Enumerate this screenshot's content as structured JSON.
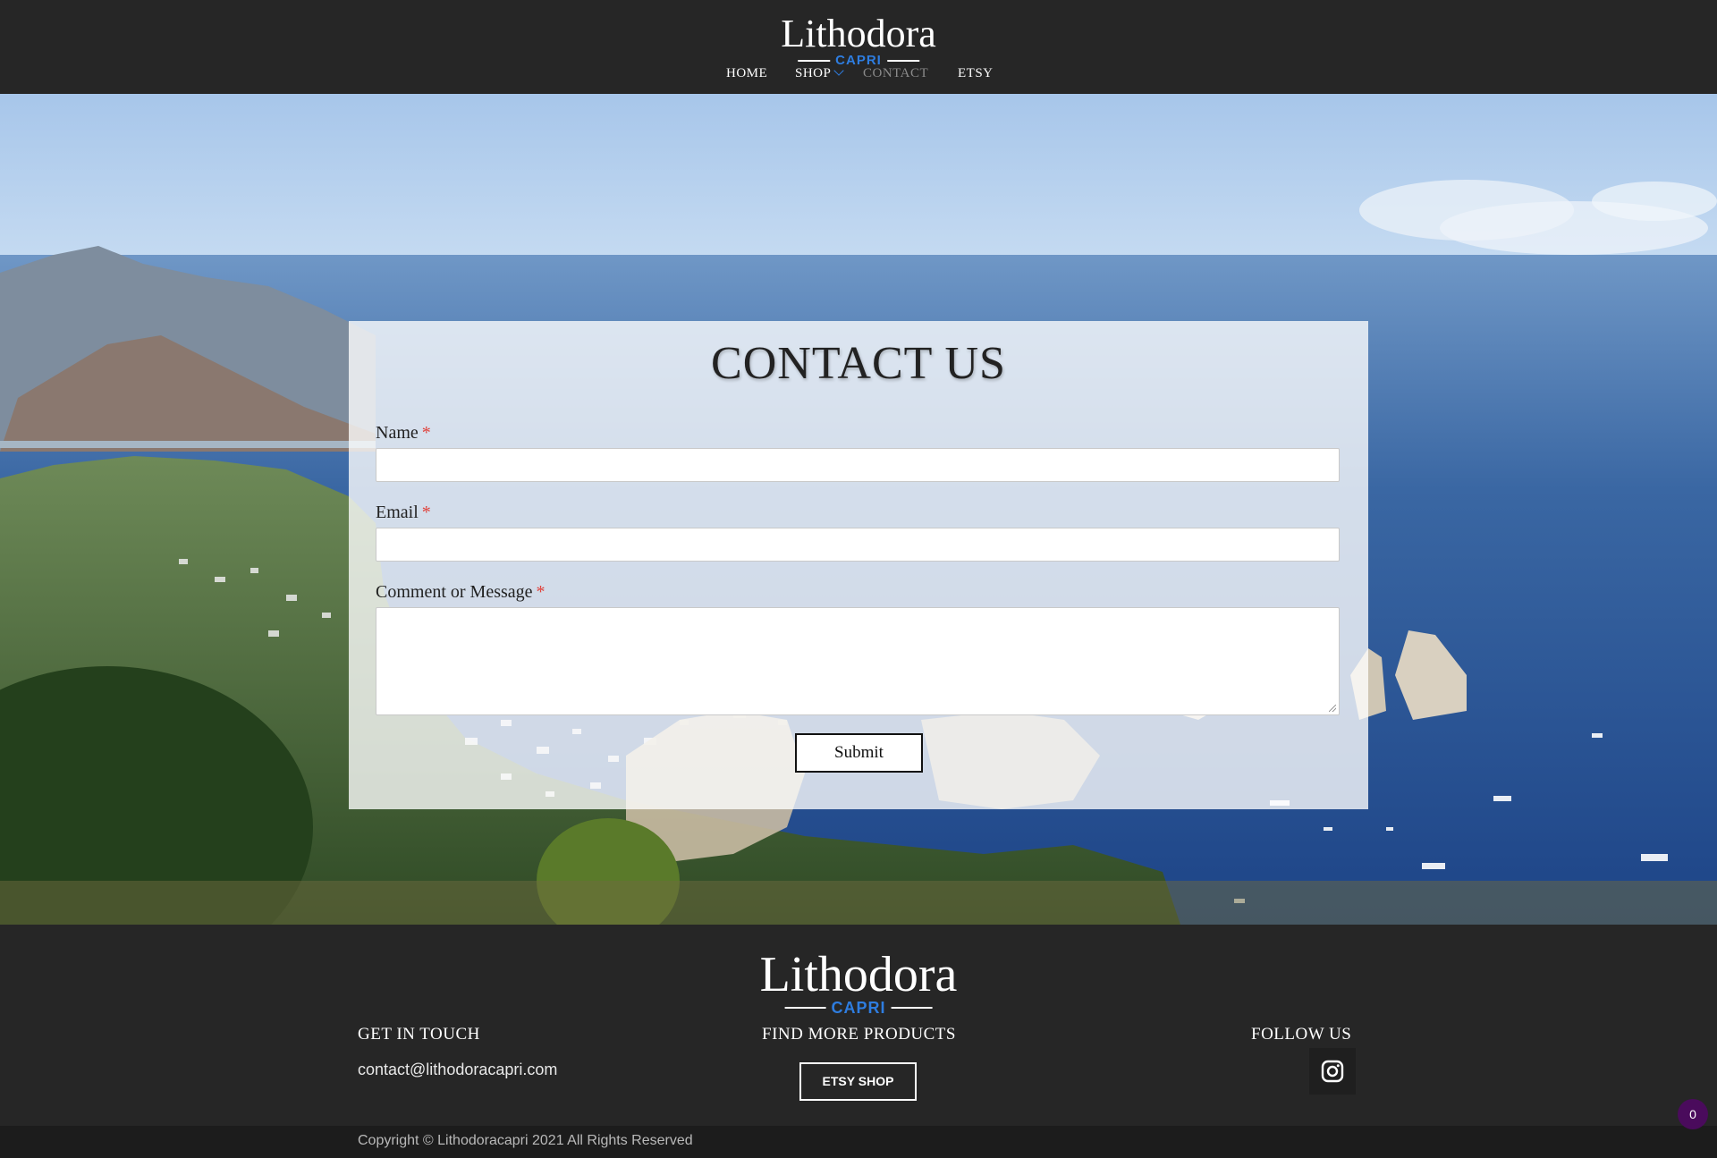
{
  "brand": {
    "name": "Lithodora",
    "subtitle": "CAPRI"
  },
  "nav": {
    "items": [
      {
        "label": "HOME"
      },
      {
        "label": "SHOP"
      },
      {
        "label": "CONTACT"
      },
      {
        "label": "ETSY"
      }
    ],
    "active": "CONTACT"
  },
  "contact": {
    "title": "CONTACT US",
    "name_label": "Name",
    "email_label": "Email",
    "message_label": "Comment or Message",
    "required_marker": "*",
    "name_value": "",
    "email_value": "",
    "message_value": "",
    "submit_label": "Submit"
  },
  "footer": {
    "get_in_touch": "GET IN TOUCH",
    "email": "contact@lithodoracapri.com",
    "find_more": "FIND MORE PRODUCTS",
    "etsy_button": "ETSY SHOP",
    "follow_us": "FOLLOW US",
    "social_icon": "instagram-icon",
    "copyright": "Copyright © Lithodoracapri 2021 All Rights Reserved"
  },
  "cart_badge": {
    "count": "0"
  },
  "colors": {
    "bar_bg": "#262626",
    "accent_blue": "#2e7de0",
    "nav_active": "#8a8a8a",
    "required": "#e0413a",
    "badge": "#4a0b5c"
  }
}
